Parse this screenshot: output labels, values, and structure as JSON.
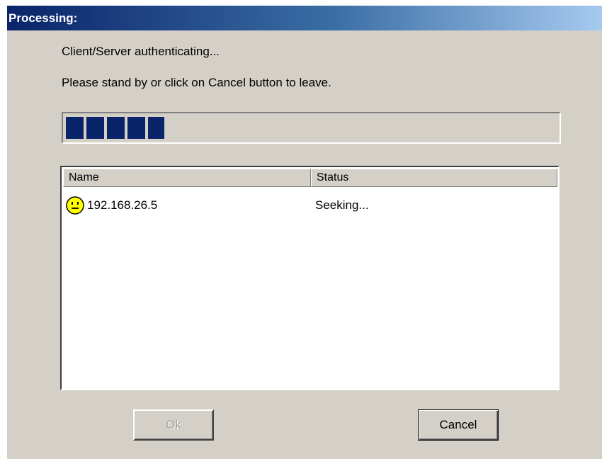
{
  "window": {
    "title": "Processing:"
  },
  "messages": {
    "line1": "Client/Server authenticating...",
    "line2": "Please stand by or click on Cancel button to leave."
  },
  "progress": {
    "fraction": 0.2,
    "color": "#0a246a"
  },
  "list": {
    "columns": [
      "Name",
      "Status"
    ],
    "rows": [
      {
        "icon": "smiley-neutral-icon",
        "name": "192.168.26.5",
        "status": "Seeking..."
      }
    ]
  },
  "buttons": {
    "ok_label": "Ok",
    "ok_enabled": false,
    "cancel_label": "Cancel"
  },
  "colors": {
    "dialog_bg": "#d4d0c8",
    "title_gradient_start": "#0a246a",
    "title_gradient_end": "#a6caf0"
  }
}
